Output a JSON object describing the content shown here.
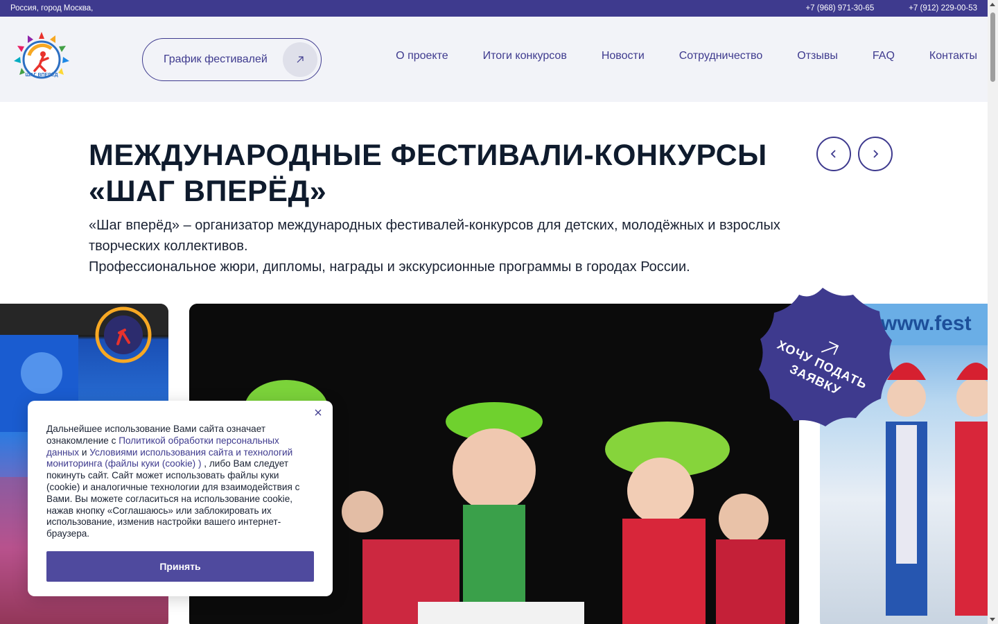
{
  "topbar": {
    "location": "Россия, город Москва,",
    "phones": [
      "+7 (968) 971-30-65",
      "+7 (912) 229-00-53"
    ]
  },
  "header": {
    "logo_icon": "shag-vpered-logo",
    "logo_text": "ШАГ ВПЕРЁД",
    "schedule_button": "График фестивалей",
    "schedule_icon": "arrow-up-right-icon",
    "nav": [
      "О проекте",
      "Итоги конкурсов",
      "Новости",
      "Сотрудничество",
      "Отзывы",
      "FAQ",
      "Контакты"
    ]
  },
  "hero": {
    "title_lines": [
      "МЕЖДУНАРОДНЫЕ ФЕСТИВАЛИ-КОНКУРСЫ",
      "«ШАГ ВПЕРЁД»"
    ],
    "description_lines": [
      "«Шаг вперёд» – организатор международных фестивалей-конкурсов для детских, молодёжных и взрослых",
      "творческих коллективов.",
      "Профессиональное жюри, дипломы, награды и экскурсионные программы в городах России."
    ],
    "prev_icon": "chevron-left-icon",
    "next_icon": "chevron-right-icon"
  },
  "slider": {
    "right_slide_text": "www.fest"
  },
  "badge": {
    "icon": "arrow-up-right-icon",
    "lines": [
      "ХОЧУ ПОДАТЬ",
      "ЗАЯВКУ"
    ]
  },
  "cookie": {
    "text_1": "Дальнейшее использование Вами сайта означает ознакомление с ",
    "link_1": "Политикой обработки персональных данных",
    "text_2": " и ",
    "link_2": "Условиями использования сайта и технологий мониторинга (файлы куки (cookie) )",
    "text_3": " , либо Вам следует покинуть сайт. Сайт может использовать файлы куки (cookie) и аналогичные технологии для взаимодействия с Вами. Вы можете согласиться на использование cookie, нажав кнопку «Соглашаюсь» или заблокировать их использование, изменив настройки вашего интернет-браузера.",
    "accept_button": "Принять",
    "close_icon": "close-icon"
  },
  "colors": {
    "brand": "#3e3a8e",
    "button": "#4f4a9e",
    "header_bg": "#f2f3f8",
    "title": "#0f1b2d"
  }
}
